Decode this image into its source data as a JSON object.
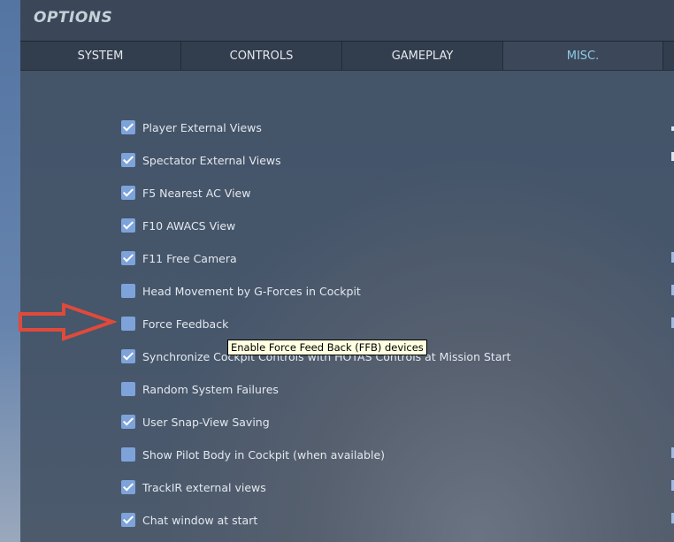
{
  "header": {
    "title": "OPTIONS"
  },
  "tabs": [
    {
      "label": "SYSTEM"
    },
    {
      "label": "CONTROLS"
    },
    {
      "label": "GAMEPLAY"
    },
    {
      "label": "MISC.",
      "active": true
    }
  ],
  "options": [
    {
      "label": "Player External Views",
      "checked": true
    },
    {
      "label": "Spectator External Views",
      "checked": true
    },
    {
      "label": "F5 Nearest AC View",
      "checked": true
    },
    {
      "label": "F10 AWACS View",
      "checked": true
    },
    {
      "label": "F11 Free Camera",
      "checked": true
    },
    {
      "label": "Head Movement by G-Forces in Cockpit",
      "checked": false
    },
    {
      "label": "Force Feedback",
      "checked": false
    },
    {
      "label": "Synchronize Cockpit Controls with HOTAS Controls at Mission Start",
      "checked": true
    },
    {
      "label": "Random System Failures",
      "checked": false
    },
    {
      "label": "User Snap-View Saving",
      "checked": true
    },
    {
      "label": "Show Pilot Body in Cockpit (when available)",
      "checked": false
    },
    {
      "label": "TrackIR external views",
      "checked": true
    },
    {
      "label": "Chat window at start",
      "checked": true
    }
  ],
  "tooltip": "Enable Force Feed Back (FFB) devices",
  "annotation": {
    "arrow_color": "#e04a3a"
  }
}
